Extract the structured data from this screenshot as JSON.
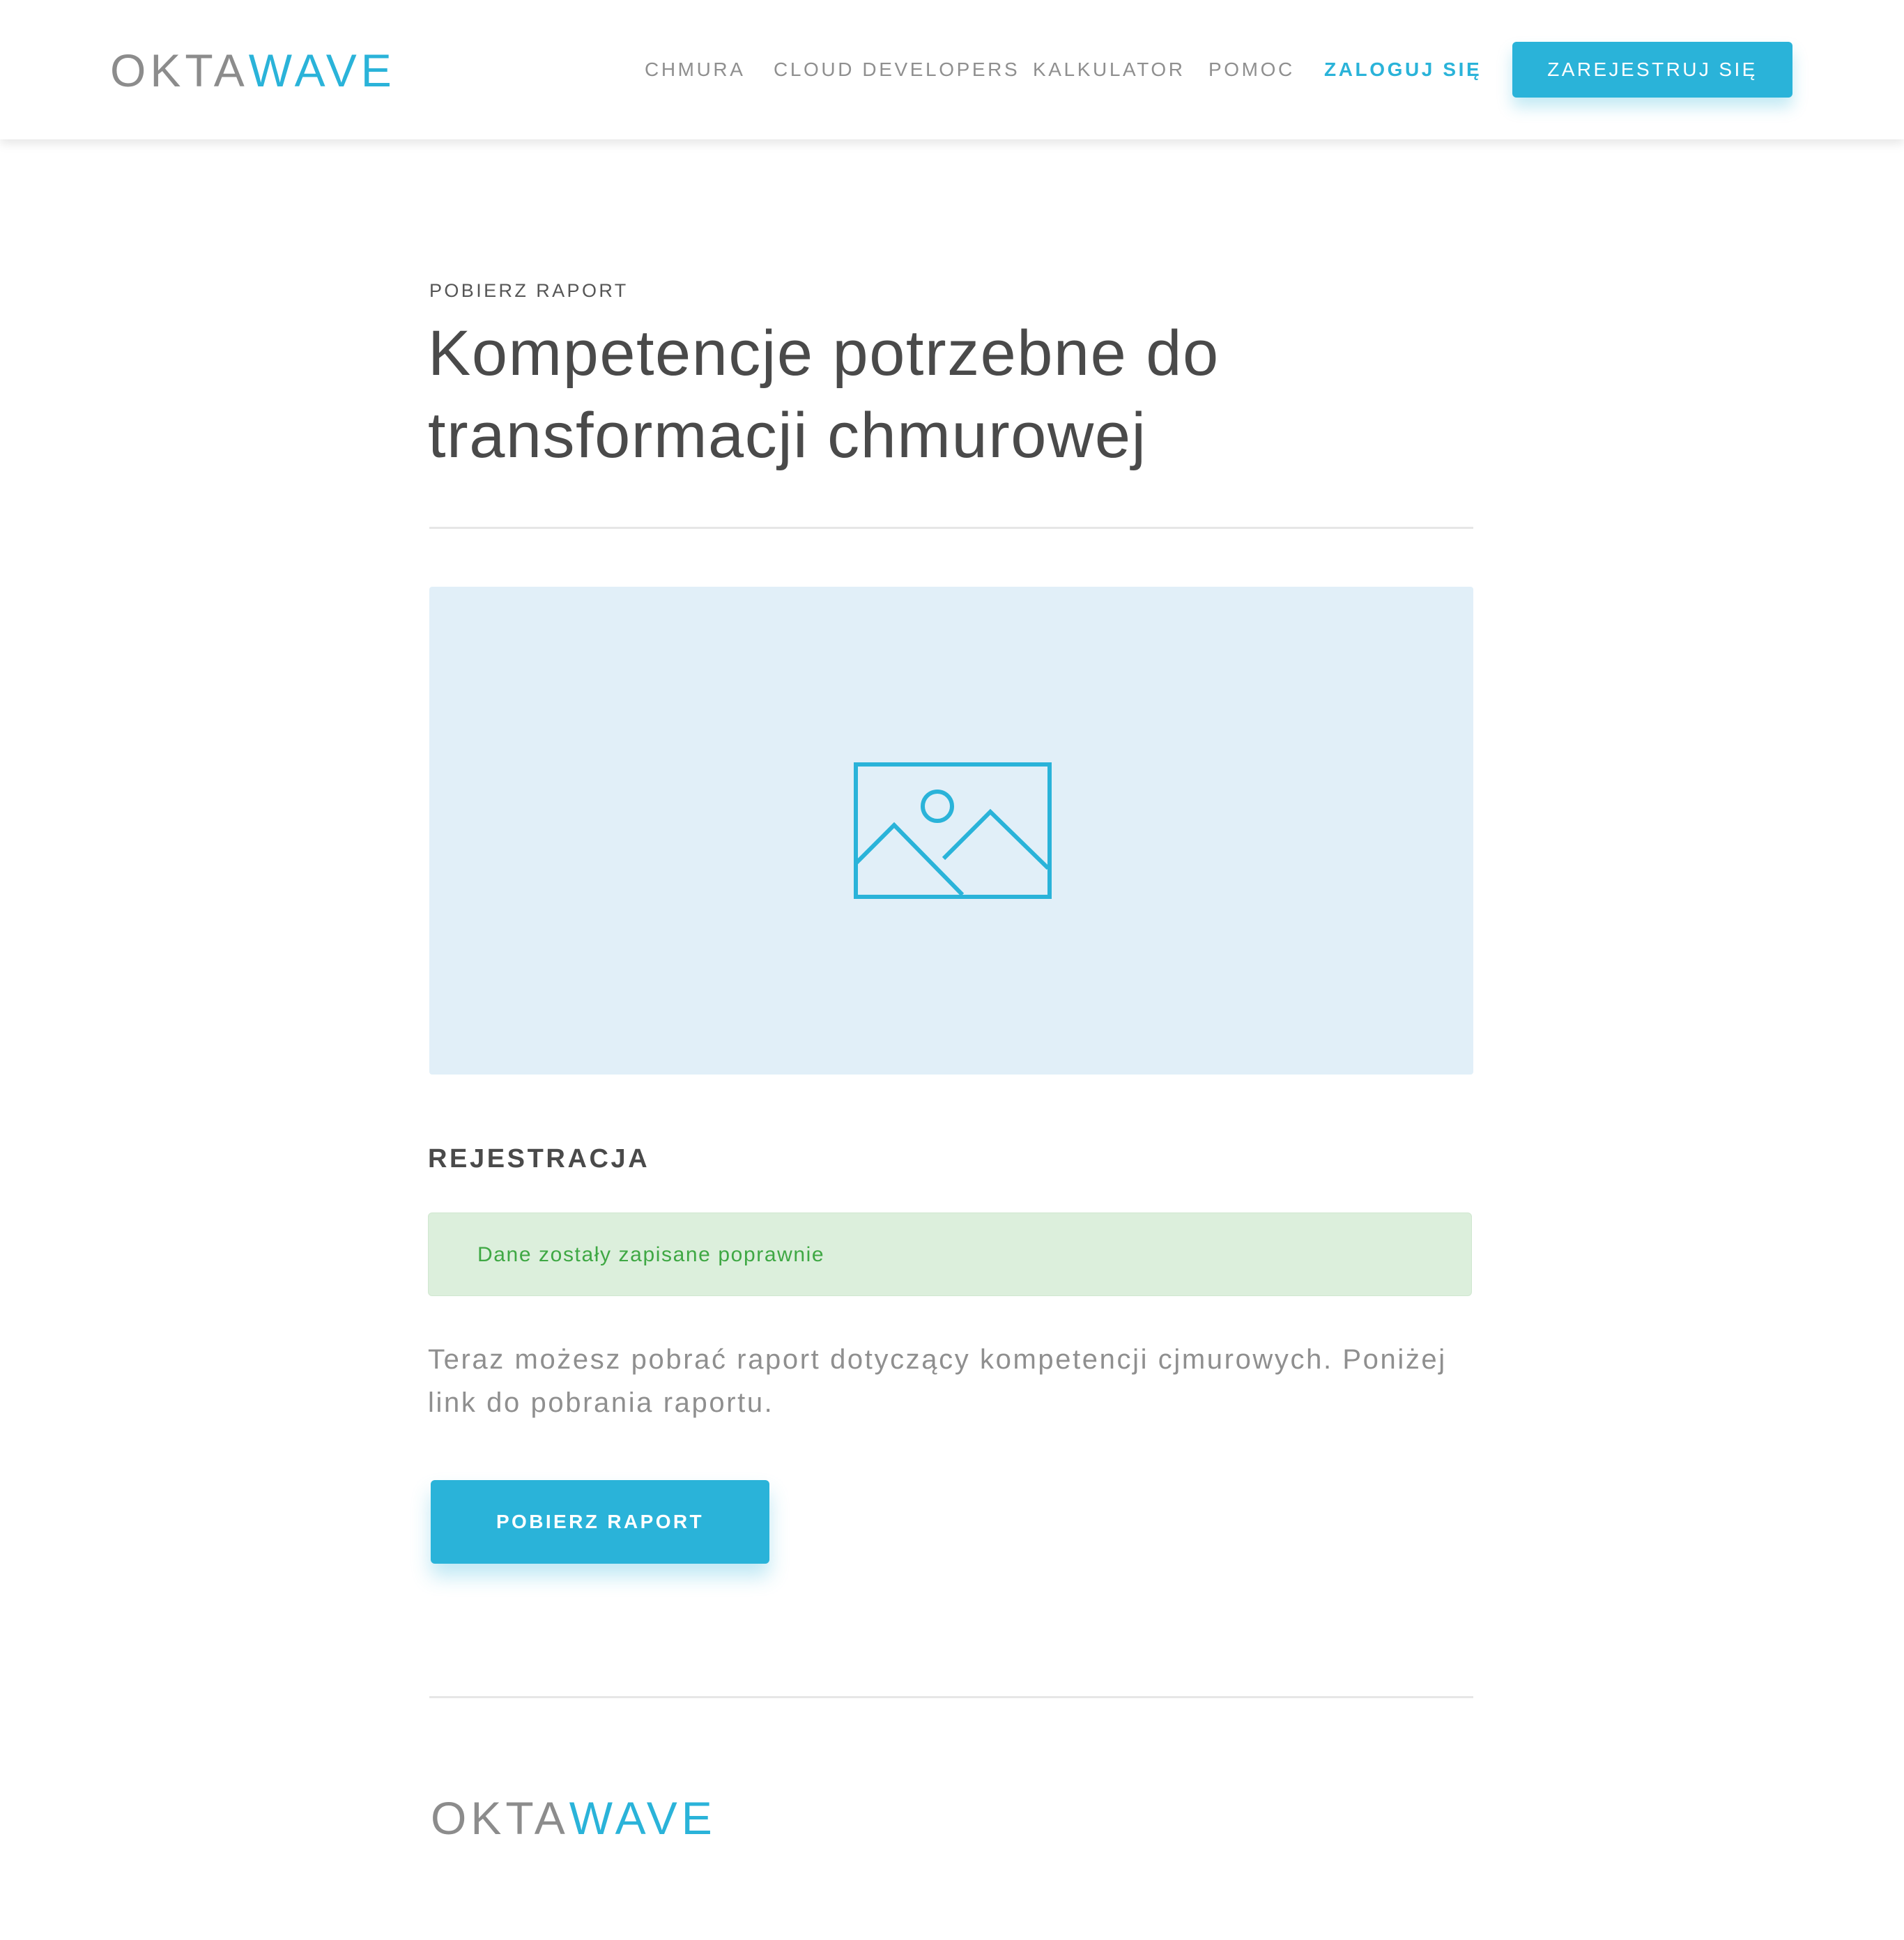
{
  "brand": {
    "logo_part_1": "OKTA",
    "logo_part_2": "WAVE",
    "accent_color": "#2ab3d9",
    "gray_color": "#8c8c8c"
  },
  "nav": {
    "items": [
      {
        "label": "CHMURA"
      },
      {
        "label": "CLOUD DEVELOPERS"
      },
      {
        "label": "KALKULATOR"
      },
      {
        "label": "POMOC"
      }
    ],
    "login_label": "ZALOGUJ SIĘ",
    "register_label": "ZAREJESTRUJ SIĘ"
  },
  "hero": {
    "eyebrow": "POBIERZ RAPORT",
    "title": "Kompetencje potrzebne do transformacji chmurowej",
    "image_icon": "image-placeholder-icon"
  },
  "registration": {
    "section_title": "REJESTRACJA",
    "success_message": "Dane zostały zapisane poprawnie",
    "success_color": "#3fa844",
    "info_text": "Teraz możesz pobrać raport dotyczący kompetencji cjmurowych. Poniżej link do pobrania raportu.",
    "download_label": "POBIERZ RAPORT"
  },
  "footer": {
    "logo_part_1": "OKTA",
    "logo_part_2": "WAVE"
  }
}
